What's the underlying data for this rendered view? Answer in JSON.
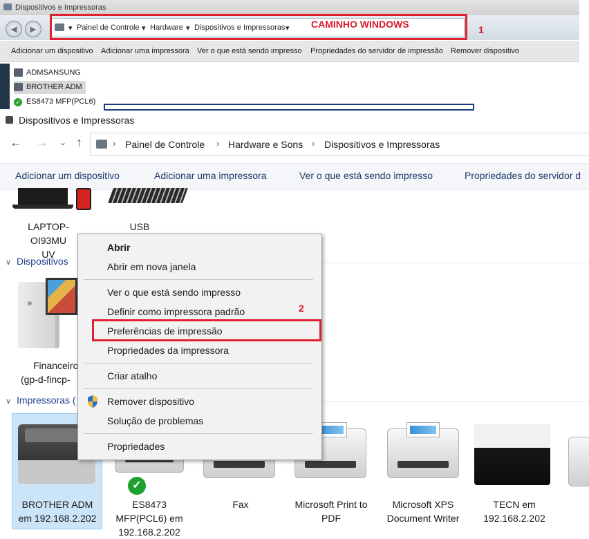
{
  "old_window": {
    "title": "Dispositivos e Impressoras",
    "address": [
      "Painel de Controle",
      "Hardware",
      "Dispositivos e Impressoras"
    ],
    "annotation_caption": "CAMINHO WINDOWS",
    "annotation_number": "1",
    "toolbar": [
      "Adicionar um dispositivo",
      "Adicionar uma impressora",
      "Ver o que está sendo impresso",
      "Propriedades do servidor de impressão",
      "Remover dispositivo"
    ],
    "devices": [
      "ADMSANSUNG",
      "BROTHER ADM",
      "ES8473 MFP(PCL6)"
    ]
  },
  "main_window": {
    "title": "Dispositivos e Impressoras",
    "address": [
      "Painel de Controle",
      "Hardware e Sons",
      "Dispositivos e Impressoras"
    ],
    "toolbar": [
      "Adicionar um dispositivo",
      "Adicionar uma impressora",
      "Ver o que está sendo impresso",
      "Propriedades do servidor d"
    ],
    "top_devices": [
      {
        "label_line1": "LAPTOP-OI93MU",
        "label_line2": "UV"
      },
      {
        "label_line1": "USB Receiver",
        "label_line2": ""
      }
    ],
    "section_multimedia": "Dispositivos",
    "multimedia_device": {
      "label_line1": "Financeiro",
      "label_line2": "(gp-d-fincp-"
    },
    "section_printers": "Impressoras (",
    "printers": [
      {
        "line1": "BROTHER ADM",
        "line2": "em 192.168.2.202",
        "selected": true
      },
      {
        "line1": "ES8473",
        "line2": "MFP(PCL6) em",
        "line3": "192.168.2.202"
      },
      {
        "line1": "Fax",
        "line2": ""
      },
      {
        "line1": "Microsoft Print to",
        "line2": "PDF"
      },
      {
        "line1": "Microsoft XPS",
        "line2": "Document Writer"
      },
      {
        "line1": "TECN em",
        "line2": "192.168.2.202"
      }
    ]
  },
  "context_menu": {
    "items": [
      "Abrir",
      "Abrir em nova janela",
      "Ver o que está sendo impresso",
      "Definir como impressora padrão",
      "Preferências de impressão",
      "Propriedades da impressora",
      "Criar atalho",
      "Remover dispositivo",
      "Solução de problemas",
      "Propriedades"
    ],
    "annotation_number": "2"
  },
  "colors": {
    "annotation_red": "#e0202e",
    "selection_blue": "#cce4f7",
    "link_blue": "#1e3e8a",
    "status_green": "#1fa12f"
  }
}
